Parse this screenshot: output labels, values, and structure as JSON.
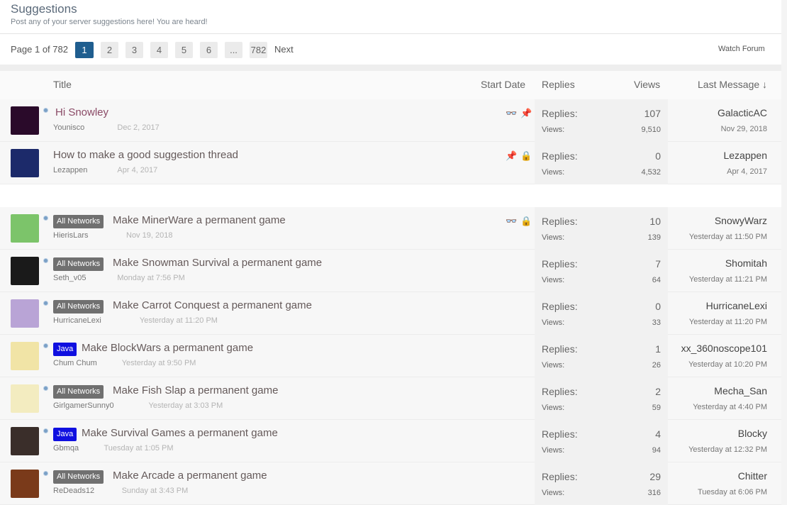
{
  "header": {
    "title": "Suggestions",
    "description": "Post any of your server suggestions here! You are heard!"
  },
  "pager": {
    "text": "Page 1 of 782",
    "pages": [
      "1",
      "2",
      "3",
      "4",
      "5",
      "6",
      "...",
      "782"
    ],
    "current": "1",
    "next": "Next",
    "watch": "Watch Forum"
  },
  "columns": {
    "title": "Title",
    "start_date": "Start Date",
    "replies": "Replies",
    "views": "Views",
    "last_message": "Last Message ↓"
  },
  "labels": {
    "replies": "Replies:",
    "views": "Views:"
  },
  "sticky_threads": [
    {
      "title": "Hi Snowley",
      "author": "Younisco",
      "date": "Dec 2, 2017",
      "icons": [
        "glasses-icon",
        "pin-icon"
      ],
      "replies": "107",
      "views": "9,510",
      "last_user": "GalacticAC",
      "last_date": "Nov 29, 2018",
      "avatar_color": "#2a0a2a"
    },
    {
      "title": "How to make a good suggestion thread",
      "author": "Lezappen",
      "date": "Apr 4, 2017",
      "icons": [
        "pin-icon",
        "lock-icon"
      ],
      "replies": "0",
      "views": "4,532",
      "last_user": "Lezappen",
      "last_date": "Apr 4, 2017",
      "avatar_color": "#1c2a6a"
    }
  ],
  "threads": [
    {
      "prefix": "All Networks",
      "prefix_color": "gray",
      "title": "Make MinerWare a permanent game",
      "author": "HierisLars",
      "date": "Nov 19, 2018",
      "icons": [
        "glasses-icon",
        "lock-icon"
      ],
      "replies": "10",
      "views": "139",
      "last_user": "SnowyWarz",
      "last_date": "Yesterday at 11:50 PM",
      "avatar_color": "#7cc46a"
    },
    {
      "prefix": "All Networks",
      "prefix_color": "gray",
      "title": "Make Snowman Survival a permanent game",
      "author": "Seth_v05",
      "date": "Monday at 7:56 PM",
      "icons": [],
      "replies": "7",
      "views": "64",
      "last_user": "Shomitah",
      "last_date": "Yesterday at 11:21 PM",
      "avatar_color": "#1a1a1a"
    },
    {
      "prefix": "All Networks",
      "prefix_color": "gray",
      "title": "Make Carrot Conquest a permanent game",
      "author": "HurricaneLexi",
      "date": "Yesterday at 11:20 PM",
      "icons": [],
      "replies": "0",
      "views": "33",
      "last_user": "HurricaneLexi",
      "last_date": "Yesterday at 11:20 PM",
      "avatar_color": "#b9a4d6"
    },
    {
      "prefix": "Java",
      "prefix_color": "blue",
      "title": "Make BlockWars a permanent game",
      "author": "Chum Chum",
      "date": "Yesterday at 9:50 PM",
      "icons": [],
      "replies": "1",
      "views": "26",
      "last_user": "xx_360noscope101",
      "last_date": "Yesterday at 10:20 PM",
      "avatar_color": "#f1e4a6"
    },
    {
      "prefix": "All Networks",
      "prefix_color": "gray",
      "title": "Make Fish Slap a permanent game",
      "author": "GirlgamerSunny0",
      "date": "Yesterday at 3:03 PM",
      "icons": [],
      "replies": "2",
      "views": "59",
      "last_user": "Mecha_San",
      "last_date": "Yesterday at 4:40 PM",
      "avatar_color": "#f3ecc0"
    },
    {
      "prefix": "Java",
      "prefix_color": "blue",
      "title": "Make Survival Games a permanent game",
      "author": "Gbmqa",
      "date": "Tuesday at 1:05 PM",
      "icons": [],
      "replies": "4",
      "views": "94",
      "last_user": "Blocky",
      "last_date": "Yesterday at 12:32 PM",
      "avatar_color": "#3a2e2a"
    },
    {
      "prefix": "All Networks",
      "prefix_color": "gray",
      "title": "Make Arcade a permanent game",
      "author": "ReDeads12",
      "date": "Sunday at 3:43 PM",
      "icons": [],
      "replies": "29",
      "views": "316",
      "last_user": "Chitter",
      "last_date": "Tuesday at 6:06 PM",
      "avatar_color": "#7a3a1a"
    }
  ]
}
